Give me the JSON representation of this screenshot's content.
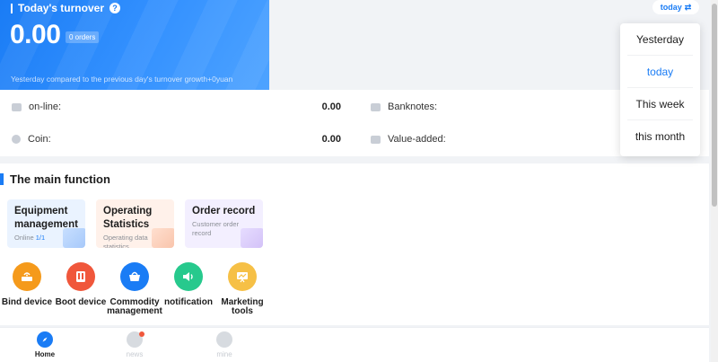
{
  "turnover": {
    "title": "Today's turnover",
    "help_icon": "?",
    "amount": "0.00",
    "orders_badge": "0 orders",
    "comparison_note": "Yesterday compared to the previous day's turnover growth+0yuan"
  },
  "period_switch": {
    "label": "today",
    "icon": "swap-icon",
    "glyph": "⇄"
  },
  "period_menu": {
    "items": [
      "Yesterday",
      "today",
      "This week",
      "this month"
    ],
    "selected": "today"
  },
  "stats": {
    "online_label": "on-line:",
    "online_value": "0.00",
    "coin_label": "Coin:",
    "coin_value": "0.00",
    "banknotes_label": "Banknotes:",
    "value_added_label": "Value-added:"
  },
  "main_function": {
    "title": "The main function",
    "cards": [
      {
        "title": "Equipment management",
        "sub_prefix": "Online ",
        "sub_value": "1/1"
      },
      {
        "title": "Operating Statistics",
        "sub": "Operating data statistics"
      },
      {
        "title": "Order record",
        "sub": "Customer order record"
      }
    ],
    "tools": [
      {
        "label": "Bind device",
        "icon": "router-icon"
      },
      {
        "label": "Boot device",
        "icon": "machine-icon"
      },
      {
        "label": "Commodity management",
        "icon": "basket-icon"
      },
      {
        "label": "notification",
        "icon": "speaker-icon"
      },
      {
        "label": "Marketing tools",
        "icon": "chart-board-icon"
      }
    ]
  },
  "bottom_nav": {
    "items": [
      {
        "label": "Home",
        "icon": "compass-icon",
        "active": true
      },
      {
        "label": "news",
        "icon": "chat-icon",
        "active": false
      },
      {
        "label": "mine",
        "icon": "user-icon",
        "active": false
      }
    ]
  },
  "colors": {
    "primary": "#1a7cf5",
    "text": "#1d1d1d",
    "muted": "#8b8f96",
    "background": "#f1f3f6"
  }
}
